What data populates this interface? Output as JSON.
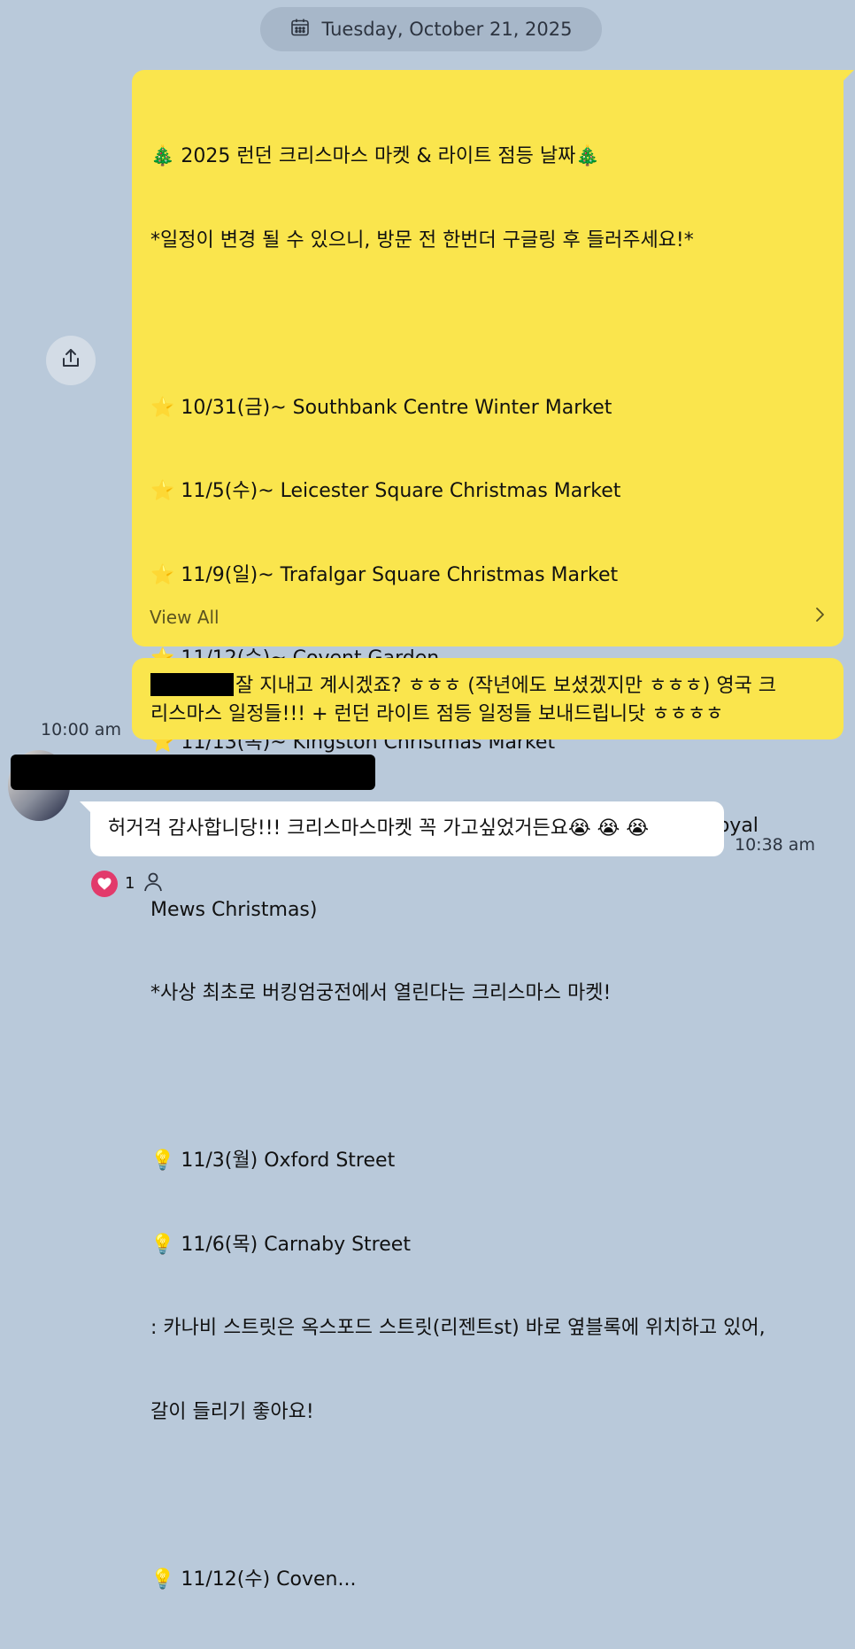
{
  "date_divider": {
    "label": "Tuesday, October 21, 2025",
    "icon": "calendar-icon"
  },
  "share_button": {
    "icon": "share-icon"
  },
  "main_message": {
    "lines": [
      "🎄 2025 런던 크리스마스 마켓 & 라이트 점등 날짜🎄",
      "*일정이 변경 될 수 있으니, 방문 전 한번더 구글링 후 들러주세요!*",
      "",
      "⭐ 10/31(금)~ Southbank Centre Winter Market",
      "⭐ 11/5(수)~ Leicester Square Christmas Market",
      "⭐ 11/9(일)~ Trafalgar Square Christmas Market",
      "⭐ 11/12(수)~ Covent Garden",
      "⭐ 11/13(목)~ Kingston Christmas Market",
      "⭐ 11/14(금) *Buckingham Palace Christmas pop-up(The Royal",
      "Mews Christmas)",
      "*사상 최초로 버킹엄궁전에서 열린다는 크리스마스 마켓!",
      "",
      "💡 11/3(월) Oxford Street",
      "💡 11/6(목) Carnaby Street",
      ": 카나비 스트릿은 옥스포드 스트릿(리젠트st) 바로 옆블록에 위치하고 있어,",
      "갈이 들리기 좋아요!",
      "",
      "💡 11/12(수) Coven..."
    ],
    "view_all_label": "View All"
  },
  "second_message": {
    "text_line1": "잘 지내고 계시겠죠? ㅎㅎㅎ (작년에도 보셨겠지만 ㅎㅎㅎ) 영국 크",
    "text_line2": "리스마스 일정들!!! + 런던 라이트 점등 일정들 보내드립니닷 ㅎㅎㅎㅎ"
  },
  "sent_time": "10:00 am",
  "reply": {
    "text": "허거걱 감사합니당!!! 크리스마스마켓 꼭 가고싶었거든요😭 😭 😭",
    "time": "10:38 am",
    "reaction_count": "1"
  },
  "colors": {
    "background": "#b9c9da",
    "my_bubble": "#fae54d",
    "their_bubble": "#ffffff",
    "heart": "#e23a6b"
  }
}
